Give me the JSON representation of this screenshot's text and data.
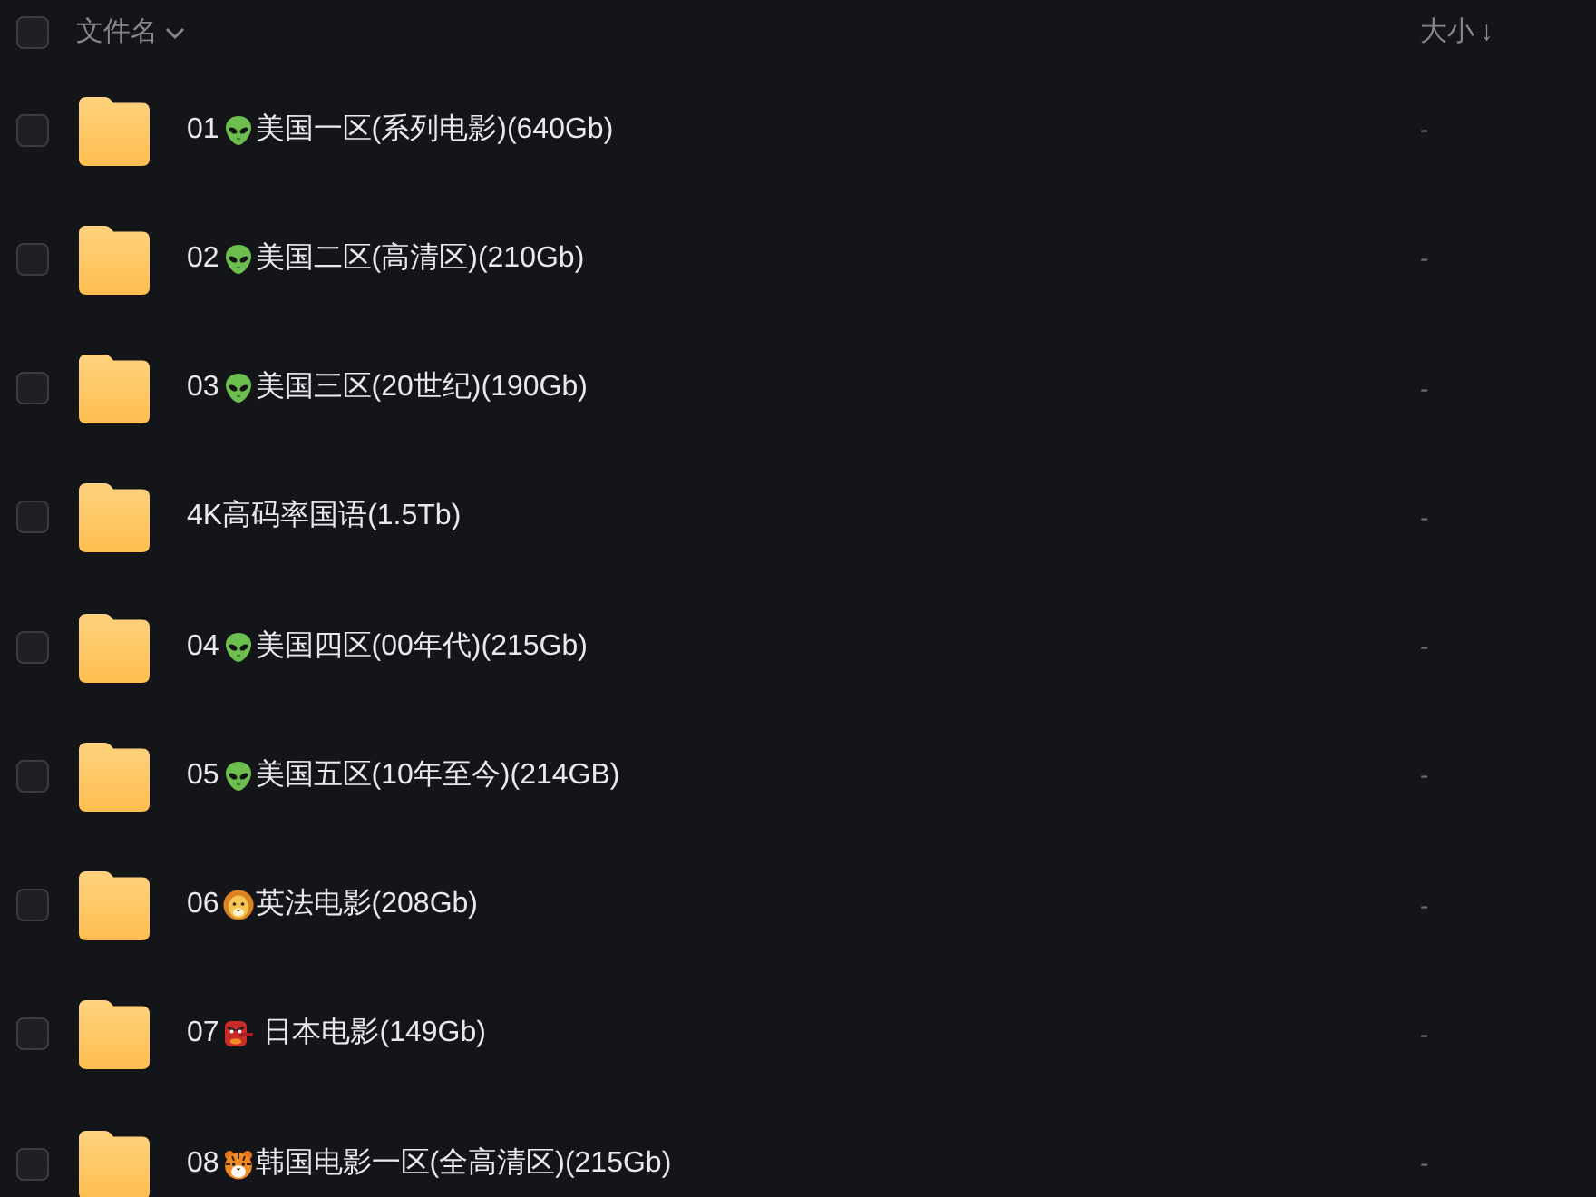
{
  "header": {
    "checked": false,
    "name_column": {
      "label": "文件名"
    },
    "size_column": {
      "label": "大小",
      "sort_arrow": "↓"
    }
  },
  "rows": [
    {
      "checked": false,
      "number": "01",
      "kind": "alien",
      "title": "美国一区(系列电影)(640Gb)",
      "size": "-"
    },
    {
      "checked": false,
      "number": "02",
      "kind": "alien",
      "title": "美国二区(高清区)(210Gb)",
      "size": "-"
    },
    {
      "checked": false,
      "number": "03",
      "kind": "alien",
      "title": "美国三区(20世纪)(190Gb)",
      "size": "-"
    },
    {
      "checked": false,
      "kind": "plain",
      "title": "4K高码率国语(1.5Tb)",
      "size": "-"
    },
    {
      "checked": false,
      "number": "04",
      "kind": "alien",
      "title": "美国四区(00年代)(215Gb)",
      "size": "-"
    },
    {
      "checked": false,
      "number": "05",
      "kind": "alien",
      "title": "美国五区(10年至今)(214GB)",
      "size": "-"
    },
    {
      "checked": false,
      "number": "06",
      "kind": "lion",
      "title": "英法电影(208Gb)",
      "size": "-"
    },
    {
      "checked": false,
      "number": "07",
      "kind": "goblin",
      "title": " 日本电影(149Gb)",
      "size": "-"
    },
    {
      "checked": false,
      "number": "08",
      "kind": "tiger",
      "title": "韩国电影一区(全高清区)(215Gb)",
      "size": "-"
    }
  ]
}
